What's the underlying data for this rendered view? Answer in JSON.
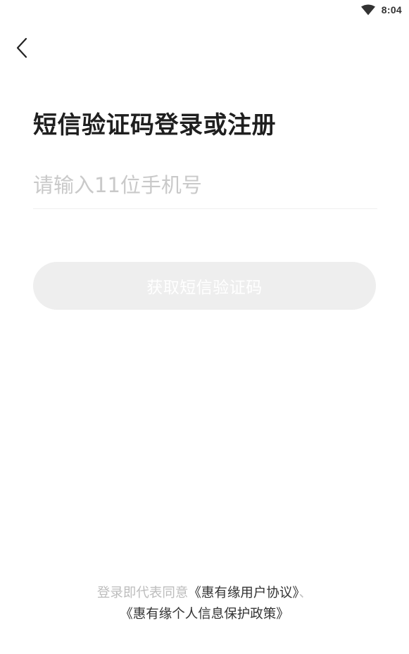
{
  "status_bar": {
    "time": "8:04",
    "wifi_icon": "wifi-icon"
  },
  "nav": {
    "back_icon": "chevron-left-icon"
  },
  "title": "短信验证码登录或注册",
  "phone_input": {
    "placeholder": "请输入11位手机号",
    "value": ""
  },
  "sms_button": {
    "label": "获取短信验证码",
    "background": "#eeeeee",
    "text_color": "#ffffff"
  },
  "agreement": {
    "prefix": "登录即代表同意",
    "user_agreement": "《惠有缘用户协议》",
    "separator": "、",
    "privacy_policy": "《惠有缘个人信息保护政策》"
  },
  "colors": {
    "placeholder": "#c9c9c9",
    "muted_text": "#bdbdbd",
    "title_text": "#1f1f1f",
    "link_text": "#333333"
  }
}
